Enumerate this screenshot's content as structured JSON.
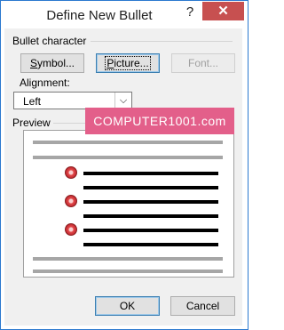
{
  "window": {
    "title": "Define New Bullet",
    "help_glyph": "?",
    "close_glyph": "✕"
  },
  "bullet_character": {
    "label": "Bullet character",
    "symbol_button": {
      "accel": "S",
      "rest": "ymbol..."
    },
    "picture_button": {
      "accel": "P",
      "rest": "icture..."
    },
    "font_button": "Font..."
  },
  "alignment": {
    "label_pre": "Ali",
    "label_accel": "g",
    "label_post": "nment:",
    "value": "Left"
  },
  "preview": {
    "label": "Preview",
    "bullet_count": 3
  },
  "watermark": "COMPUTER1001.com",
  "footer": {
    "ok_label": "OK",
    "cancel_label": "Cancel"
  },
  "colors": {
    "close_button": "#c75050",
    "watermark_bg": "#e35f8a",
    "bullet": "#d43c46"
  }
}
